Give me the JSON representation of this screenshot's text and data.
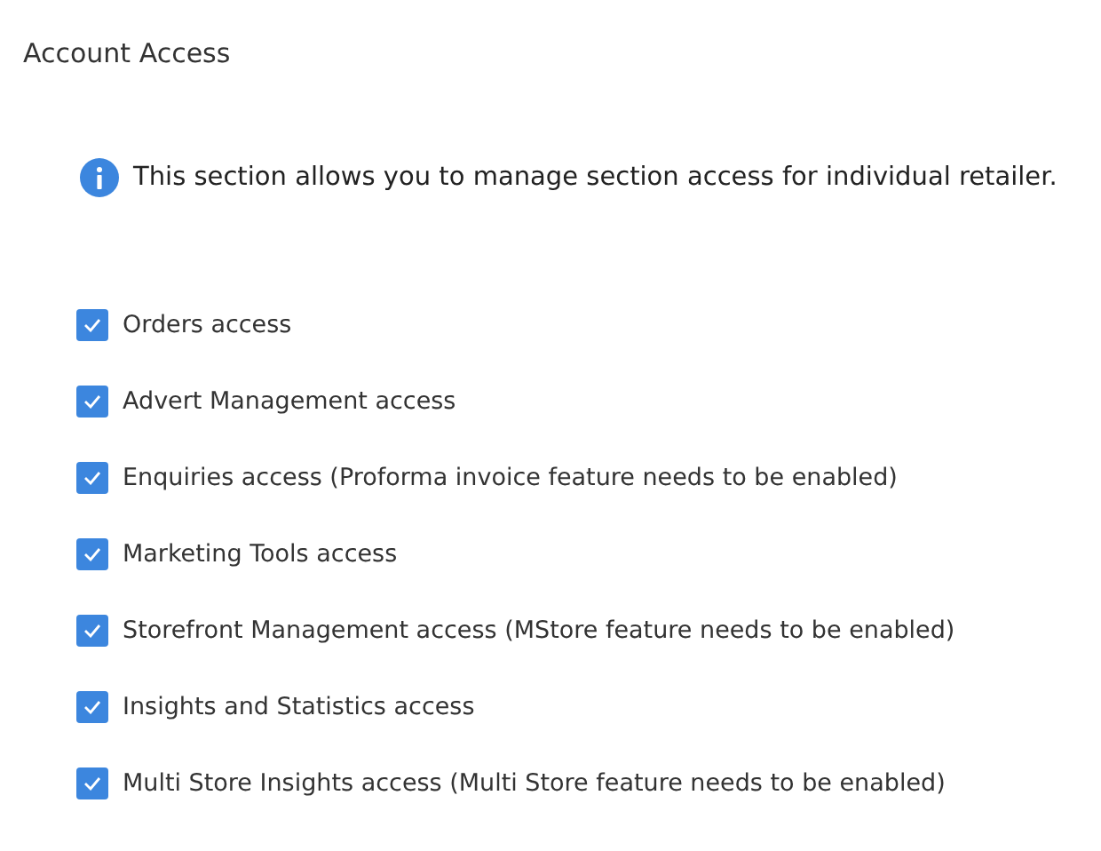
{
  "title": "Account Access",
  "info": "This section allows you to manage section access for individual retailer.",
  "permissions": [
    {
      "label": "Orders access",
      "checked": true
    },
    {
      "label": "Advert Management access",
      "checked": true
    },
    {
      "label": "Enquiries access (Proforma invoice feature needs to be enabled)",
      "checked": true
    },
    {
      "label": "Marketing Tools access",
      "checked": true
    },
    {
      "label": "Storefront Management access (MStore feature needs to be enabled)",
      "checked": true
    },
    {
      "label": "Insights and Statistics access",
      "checked": true
    },
    {
      "label": "Multi Store Insights access (Multi Store feature needs to be enabled)",
      "checked": true
    }
  ]
}
